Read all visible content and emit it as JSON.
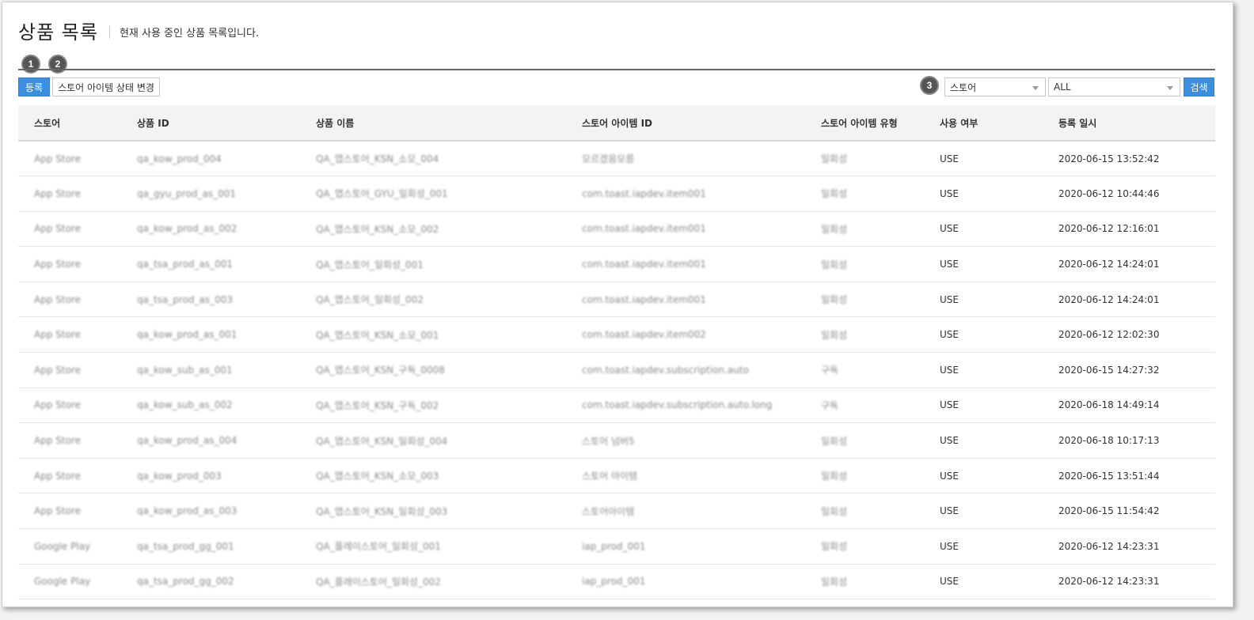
{
  "header": {
    "title": "상품 목록",
    "description": "현재 사용 중인 상품 목록입니다."
  },
  "callouts": [
    "1",
    "2",
    "3"
  ],
  "toolbar": {
    "register_label": "등록",
    "change_status_label": "스토어 아이템 상태 변경",
    "search_label": "검색"
  },
  "filters": {
    "store_selected": "스토어",
    "type_selected": "ALL"
  },
  "table": {
    "columns": [
      "스토어",
      "상품 ID",
      "상품 이름",
      "스토어 아이템 ID",
      "스토어 아이템 유형",
      "사용 여부",
      "등록 일시"
    ],
    "rows": [
      [
        "App Store",
        "qa_kow_prod_004",
        "QA_앱스토어_KSN_소모_004",
        "모르겠음모름",
        "일회성",
        "USE",
        "2020-06-15 13:52:42"
      ],
      [
        "App Store",
        "qa_gyu_prod_as_001",
        "QA_앱스토어_GYU_일회성_001",
        "com.toast.iapdev.item001",
        "일회성",
        "USE",
        "2020-06-12 10:44:46"
      ],
      [
        "App Store",
        "qa_kow_prod_as_002",
        "QA_앱스토어_KSN_소모_002",
        "com.toast.iapdev.item001",
        "일회성",
        "USE",
        "2020-06-12 12:16:01"
      ],
      [
        "App Store",
        "qa_tsa_prod_as_001",
        "QA_앱스토어_일회성_001",
        "com.toast.iapdev.item001",
        "일회성",
        "USE",
        "2020-06-12 14:24:01"
      ],
      [
        "App Store",
        "qa_tsa_prod_as_003",
        "QA_앱스토어_일회성_002",
        "com.toast.iapdev.item001",
        "일회성",
        "USE",
        "2020-06-12 14:24:01"
      ],
      [
        "App Store",
        "qa_kow_prod_as_001",
        "QA_앱스토어_KSN_소모_001",
        "com.toast.iapdev.item002",
        "일회성",
        "USE",
        "2020-06-12 12:02:30"
      ],
      [
        "App Store",
        "qa_kow_sub_as_001",
        "QA_앱스토어_KSN_구독_0008",
        "com.toast.iapdev.subscription.auto",
        "구독",
        "USE",
        "2020-06-15 14:27:32"
      ],
      [
        "App Store",
        "qa_kow_sub_as_002",
        "QA_앱스토어_KSN_구독_002",
        "com.toast.iapdev.subscription.auto.long",
        "구독",
        "USE",
        "2020-06-18 14:49:14"
      ],
      [
        "App Store",
        "qa_kow_prod_as_004",
        "QA_앱스토어_KSN_일회성_004",
        "스토어 넘버5",
        "일회성",
        "USE",
        "2020-06-18 10:17:13"
      ],
      [
        "App Store",
        "qa_kow_prod_003",
        "QA_앱스토어_KSN_소모_003",
        "스토어 아이템",
        "일회성",
        "USE",
        "2020-06-15 13:51:44"
      ],
      [
        "App Store",
        "qa_kow_prod_as_003",
        "QA_앱스토어_KSN_일회성_003",
        "스토어아이템",
        "일회성",
        "USE",
        "2020-06-15 11:54:42"
      ],
      [
        "Google Play",
        "qa_tsa_prod_gg_001",
        "QA_플레이스토어_일회성_001",
        "iap_prod_001",
        "일회성",
        "USE",
        "2020-06-12 14:23:31"
      ],
      [
        "Google Play",
        "qa_tsa_prod_gg_002",
        "QA_플레이스토어_일회성_002",
        "iap_prod_001",
        "일회성",
        "USE",
        "2020-06-12 14:23:31"
      ]
    ]
  }
}
